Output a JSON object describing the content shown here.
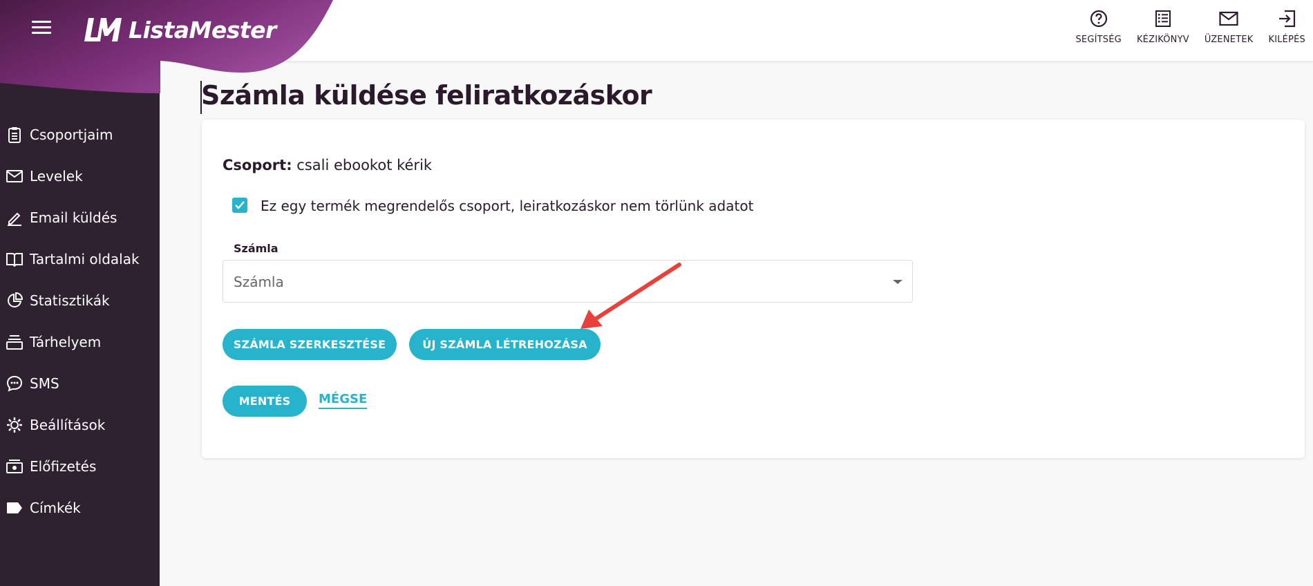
{
  "app": {
    "name": "ListaMester"
  },
  "sidebar": {
    "items": [
      {
        "label": "Csoportjaim",
        "icon": "clipboard-icon"
      },
      {
        "label": "Levelek",
        "icon": "envelope-icon"
      },
      {
        "label": "Email küldés",
        "icon": "pen-icon"
      },
      {
        "label": "Tartalmi oldalak",
        "icon": "book-icon"
      },
      {
        "label": "Statisztikák",
        "icon": "pie-chart-icon"
      },
      {
        "label": "Tárhelyem",
        "icon": "storage-icon"
      },
      {
        "label": "SMS",
        "icon": "chat-icon"
      },
      {
        "label": "Beállítások",
        "icon": "gear-icon"
      },
      {
        "label": "Előfizetés",
        "icon": "money-icon"
      },
      {
        "label": "Címkék",
        "icon": "tag-icon"
      }
    ]
  },
  "topbar": {
    "actions": [
      {
        "label": "SEGÍTSÉG",
        "icon": "help-icon"
      },
      {
        "label": "KÉZIKÖNYV",
        "icon": "manual-icon"
      },
      {
        "label": "ÜZENETEK",
        "icon": "mail-icon"
      },
      {
        "label": "KILÉPÉS",
        "icon": "logout-icon"
      }
    ]
  },
  "page": {
    "title": "Számla küldése feliratkozáskor",
    "group_label": "Csoport:",
    "group_value": "csali ebookot kérik",
    "checkbox_checked": true,
    "checkbox_label": "Ez egy termék megrendelős csoport, leiratkozáskor nem törlünk adatot",
    "invoice_field_label": "Számla",
    "invoice_selected": "Számla",
    "edit_button": "SZÁMLA SZERKESZTÉSE",
    "new_button": "ÚJ SZÁMLA LÉTREHOZÁSA",
    "save_button": "MENTÉS",
    "cancel_link": "MÉGSE"
  },
  "colors": {
    "accent": "#27b3cc",
    "sidebar_bg": "#2f2230",
    "brand_purple": "#8e3a8a",
    "annotation_arrow": "#e8403c"
  }
}
